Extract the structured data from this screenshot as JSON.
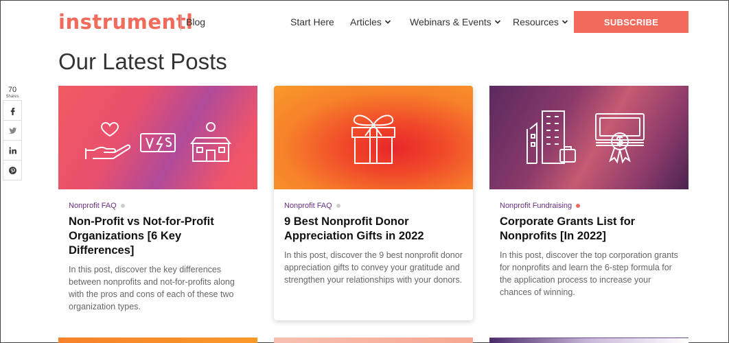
{
  "header": {
    "logo": "instrumentl",
    "blog": "Blog",
    "nav": [
      {
        "label": "Start Here",
        "has_menu": false
      },
      {
        "label": "Articles",
        "has_menu": true
      },
      {
        "label": "Webinars & Events",
        "has_menu": true
      },
      {
        "label": "Resources",
        "has_menu": true
      }
    ],
    "subscribe": "SUBSCRIBE"
  },
  "page_title": "Our Latest Posts",
  "share": {
    "count": "70",
    "label": "Shares",
    "buttons": [
      "facebook-icon",
      "twitter-icon",
      "linkedin-icon",
      "pinterest-icon"
    ]
  },
  "posts": [
    {
      "category": "Nonprofit FAQ",
      "dot_color": "#cccccc",
      "title": "Non-Profit vs Not-for-Profit Organizations [6 Key Differences]",
      "description": "In this post, discover the key differences between nonprofits and not-for-profits along with the pros and cons of each of these two organization types.",
      "image_icons": [
        "heart-hand-icon",
        "versus-icon",
        "school-building-icon"
      ]
    },
    {
      "category": "Nonprofit FAQ",
      "dot_color": "#cccccc",
      "title": "9 Best Nonprofit Donor Appreciation Gifts in 2022",
      "description": "In this post, discover the 9 best nonprofit donor appreciation gifts to convey your gratitude and strengthen your relationships with your donors.",
      "image_icons": [
        "gift-box-icon"
      ]
    },
    {
      "category": "Nonprofit Fundraising",
      "dot_color": "#f26a5b",
      "title": "Corporate Grants List for Nonprofits [In 2022]",
      "description": "In this post, discover the top corporation grants for nonprofits and learn the 6-step formula for the application process to increase your chances of winning.",
      "image_icons": [
        "office-building-icon",
        "money-award-icon"
      ]
    }
  ],
  "colors": {
    "brand": "#f26a5b",
    "category": "#6a2c83"
  }
}
